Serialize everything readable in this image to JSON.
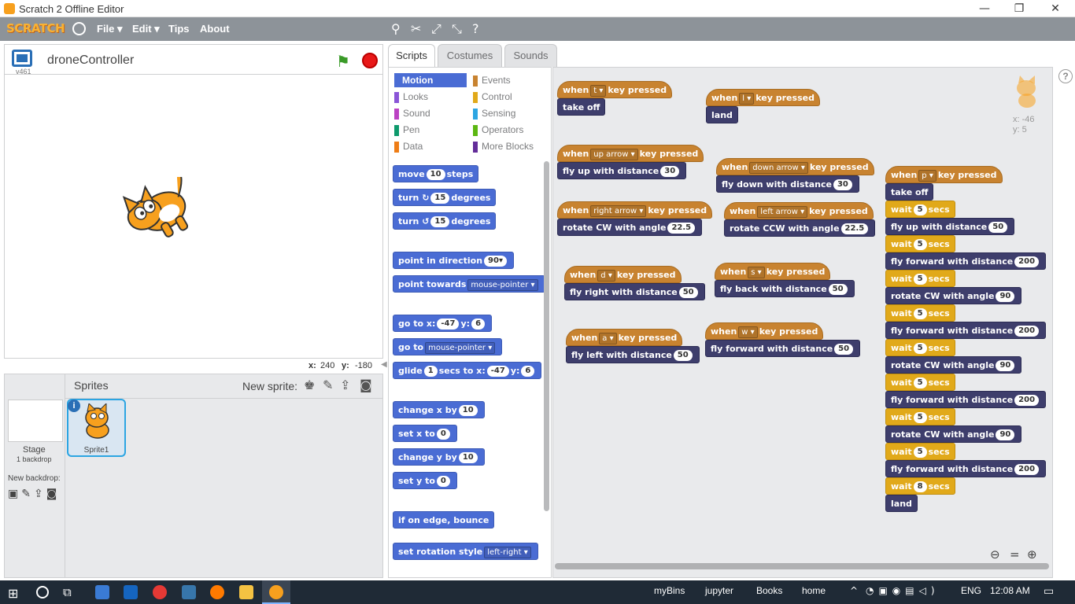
{
  "window": {
    "title": "Scratch 2 Offline Editor",
    "min": "—",
    "restore": "❐",
    "close": "✕"
  },
  "menubar": {
    "logo": "SCRATCH",
    "items": [
      "File ▾",
      "Edit ▾",
      "Tips",
      "About"
    ]
  },
  "stage": {
    "project_name": "droneController",
    "version": "v461",
    "mouse_x_label": "x:",
    "mouse_x": "240",
    "mouse_y_label": "y:",
    "mouse_y": "-180"
  },
  "sprites_pane": {
    "title": "Sprites",
    "new_sprite_label": "New sprite:",
    "stage_label": "Stage",
    "stage_backdrops": "1 backdrop",
    "new_backdrop_label": "New backdrop:",
    "sprite1": "Sprite1"
  },
  "tabs": [
    "Scripts",
    "Costumes",
    "Sounds"
  ],
  "categories": [
    {
      "label": "Motion",
      "color": "#4a6cd4"
    },
    {
      "label": "Events",
      "color": "#c88330"
    },
    {
      "label": "Looks",
      "color": "#8a55d7"
    },
    {
      "label": "Control",
      "color": "#e1a91a"
    },
    {
      "label": "Sound",
      "color": "#bb42c3"
    },
    {
      "label": "Sensing",
      "color": "#2ca5e2"
    },
    {
      "label": "Pen",
      "color": "#0e9a6c"
    },
    {
      "label": "Operators",
      "color": "#5cb712"
    },
    {
      "label": "Data",
      "color": "#ee7d16"
    },
    {
      "label": "More Blocks",
      "color": "#632d99"
    }
  ],
  "palette": {
    "move": [
      "move",
      "10",
      "steps"
    ],
    "turn_cw": [
      "turn",
      "15",
      "degrees"
    ],
    "turn_ccw": [
      "turn",
      "15",
      "degrees"
    ],
    "point_dir": [
      "point in direction",
      "90▾"
    ],
    "point_towards": [
      "point towards",
      "mouse-pointer ▾"
    ],
    "goto_xy": [
      "go to x:",
      "-47",
      "y:",
      "6"
    ],
    "goto": [
      "go to",
      "mouse-pointer ▾"
    ],
    "glide": [
      "glide",
      "1",
      "secs to x:",
      "-47",
      "y:",
      "6"
    ],
    "change_x": [
      "change x by",
      "10"
    ],
    "set_x": [
      "set x to",
      "0"
    ],
    "change_y": [
      "change y by",
      "10"
    ],
    "set_y": [
      "set y to",
      "0"
    ],
    "bounce": "if on edge, bounce",
    "rot_style": [
      "set rotation style",
      "left-right ▾"
    ]
  },
  "scripts": {
    "sprite_x": "x: -46",
    "sprite_y": "y: 5",
    "when": "when",
    "key_pressed": "key pressed",
    "s1": {
      "key": "t ▾",
      "cmd": "take off"
    },
    "s2": {
      "key": "l ▾",
      "cmd": "land"
    },
    "s3": {
      "key": "up arrow ▾",
      "cmd": "fly up with distance",
      "val": "30"
    },
    "s4": {
      "key": "down arrow ▾",
      "cmd": "fly down with distance",
      "val": "30"
    },
    "s5": {
      "key": "right arrow ▾",
      "cmd": "rotate CW with angle",
      "val": "22.5"
    },
    "s6": {
      "key": "left arrow ▾",
      "cmd": "rotate CCW with angle",
      "val": "22.5"
    },
    "s7": {
      "key": "d ▾",
      "cmd": "fly right with distance",
      "val": "50"
    },
    "s8": {
      "key": "s ▾",
      "cmd": "fly back with distance",
      "val": "50"
    },
    "s9": {
      "key": "a ▾",
      "cmd": "fly left with distance",
      "val": "50"
    },
    "s10": {
      "key": "w ▾",
      "cmd": "fly forward with distance",
      "val": "50"
    },
    "p": {
      "key": "p ▾",
      "takeoff": "take off",
      "wait": "wait",
      "secs": "secs",
      "w5": "5",
      "w8": "8",
      "flyup": "fly up with distance",
      "up_val": "50",
      "flyfwd": "fly forward with distance",
      "fwd_val": "200",
      "rotcw": "rotate CW with angle",
      "rot_val": "90",
      "land": "land"
    }
  },
  "taskbar": {
    "items": [
      "myBins",
      "jupyter",
      "Books",
      "home"
    ],
    "lang": "ENG",
    "time": "12:08 AM"
  }
}
